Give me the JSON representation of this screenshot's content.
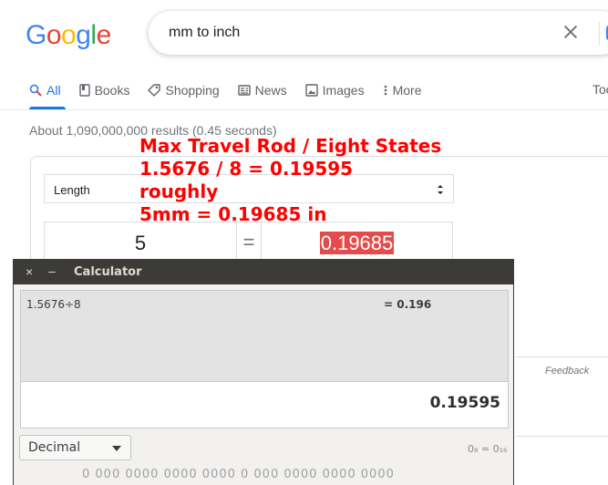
{
  "google": {
    "logo_letters": [
      {
        "ch": "G",
        "color": "#4285f4"
      },
      {
        "ch": "o",
        "color": "#ea4335"
      },
      {
        "ch": "o",
        "color": "#fbbc05"
      },
      {
        "ch": "g",
        "color": "#4285f4"
      },
      {
        "ch": "l",
        "color": "#34a853"
      },
      {
        "ch": "e",
        "color": "#ea4335"
      }
    ],
    "search_query": "mm to inch",
    "tabs": [
      {
        "label": "All",
        "icon": "search-icon",
        "active": true
      },
      {
        "label": "Books",
        "icon": "book-icon",
        "active": false
      },
      {
        "label": "Shopping",
        "icon": "tag-icon",
        "active": false
      },
      {
        "label": "News",
        "icon": "newspaper-icon",
        "active": false
      },
      {
        "label": "Images",
        "icon": "image-icon",
        "active": false
      },
      {
        "label": "More",
        "icon": "more-vert-icon",
        "active": false
      }
    ],
    "tools_label": "Too",
    "result_stats": "About 1,090,000,000 results (0.45 seconds)",
    "accent_color": "#1a73e8"
  },
  "converter": {
    "unit_type": "Length",
    "input_value": "5",
    "equals": "=",
    "output_value": "0.19685",
    "feedback_label": "Feedback"
  },
  "annotation": {
    "lines": [
      "Max Travel Rod / Eight States",
      "1.5676 / 8 = 0.19595",
      "roughly",
      "5mm = 0.19685 in"
    ],
    "color": "#ff0000"
  },
  "calculator": {
    "title": "Calculator",
    "close_glyph": "×",
    "minimize_glyph": "–",
    "history_expression": "1.5676÷8",
    "history_result": "= 0.196",
    "display_value": "0.19595",
    "mode": "Decimal",
    "base_info": "0₈ = 0₁₆",
    "bits": "0 000  0000  0000  0000  0 000  0000  0000  0000"
  }
}
